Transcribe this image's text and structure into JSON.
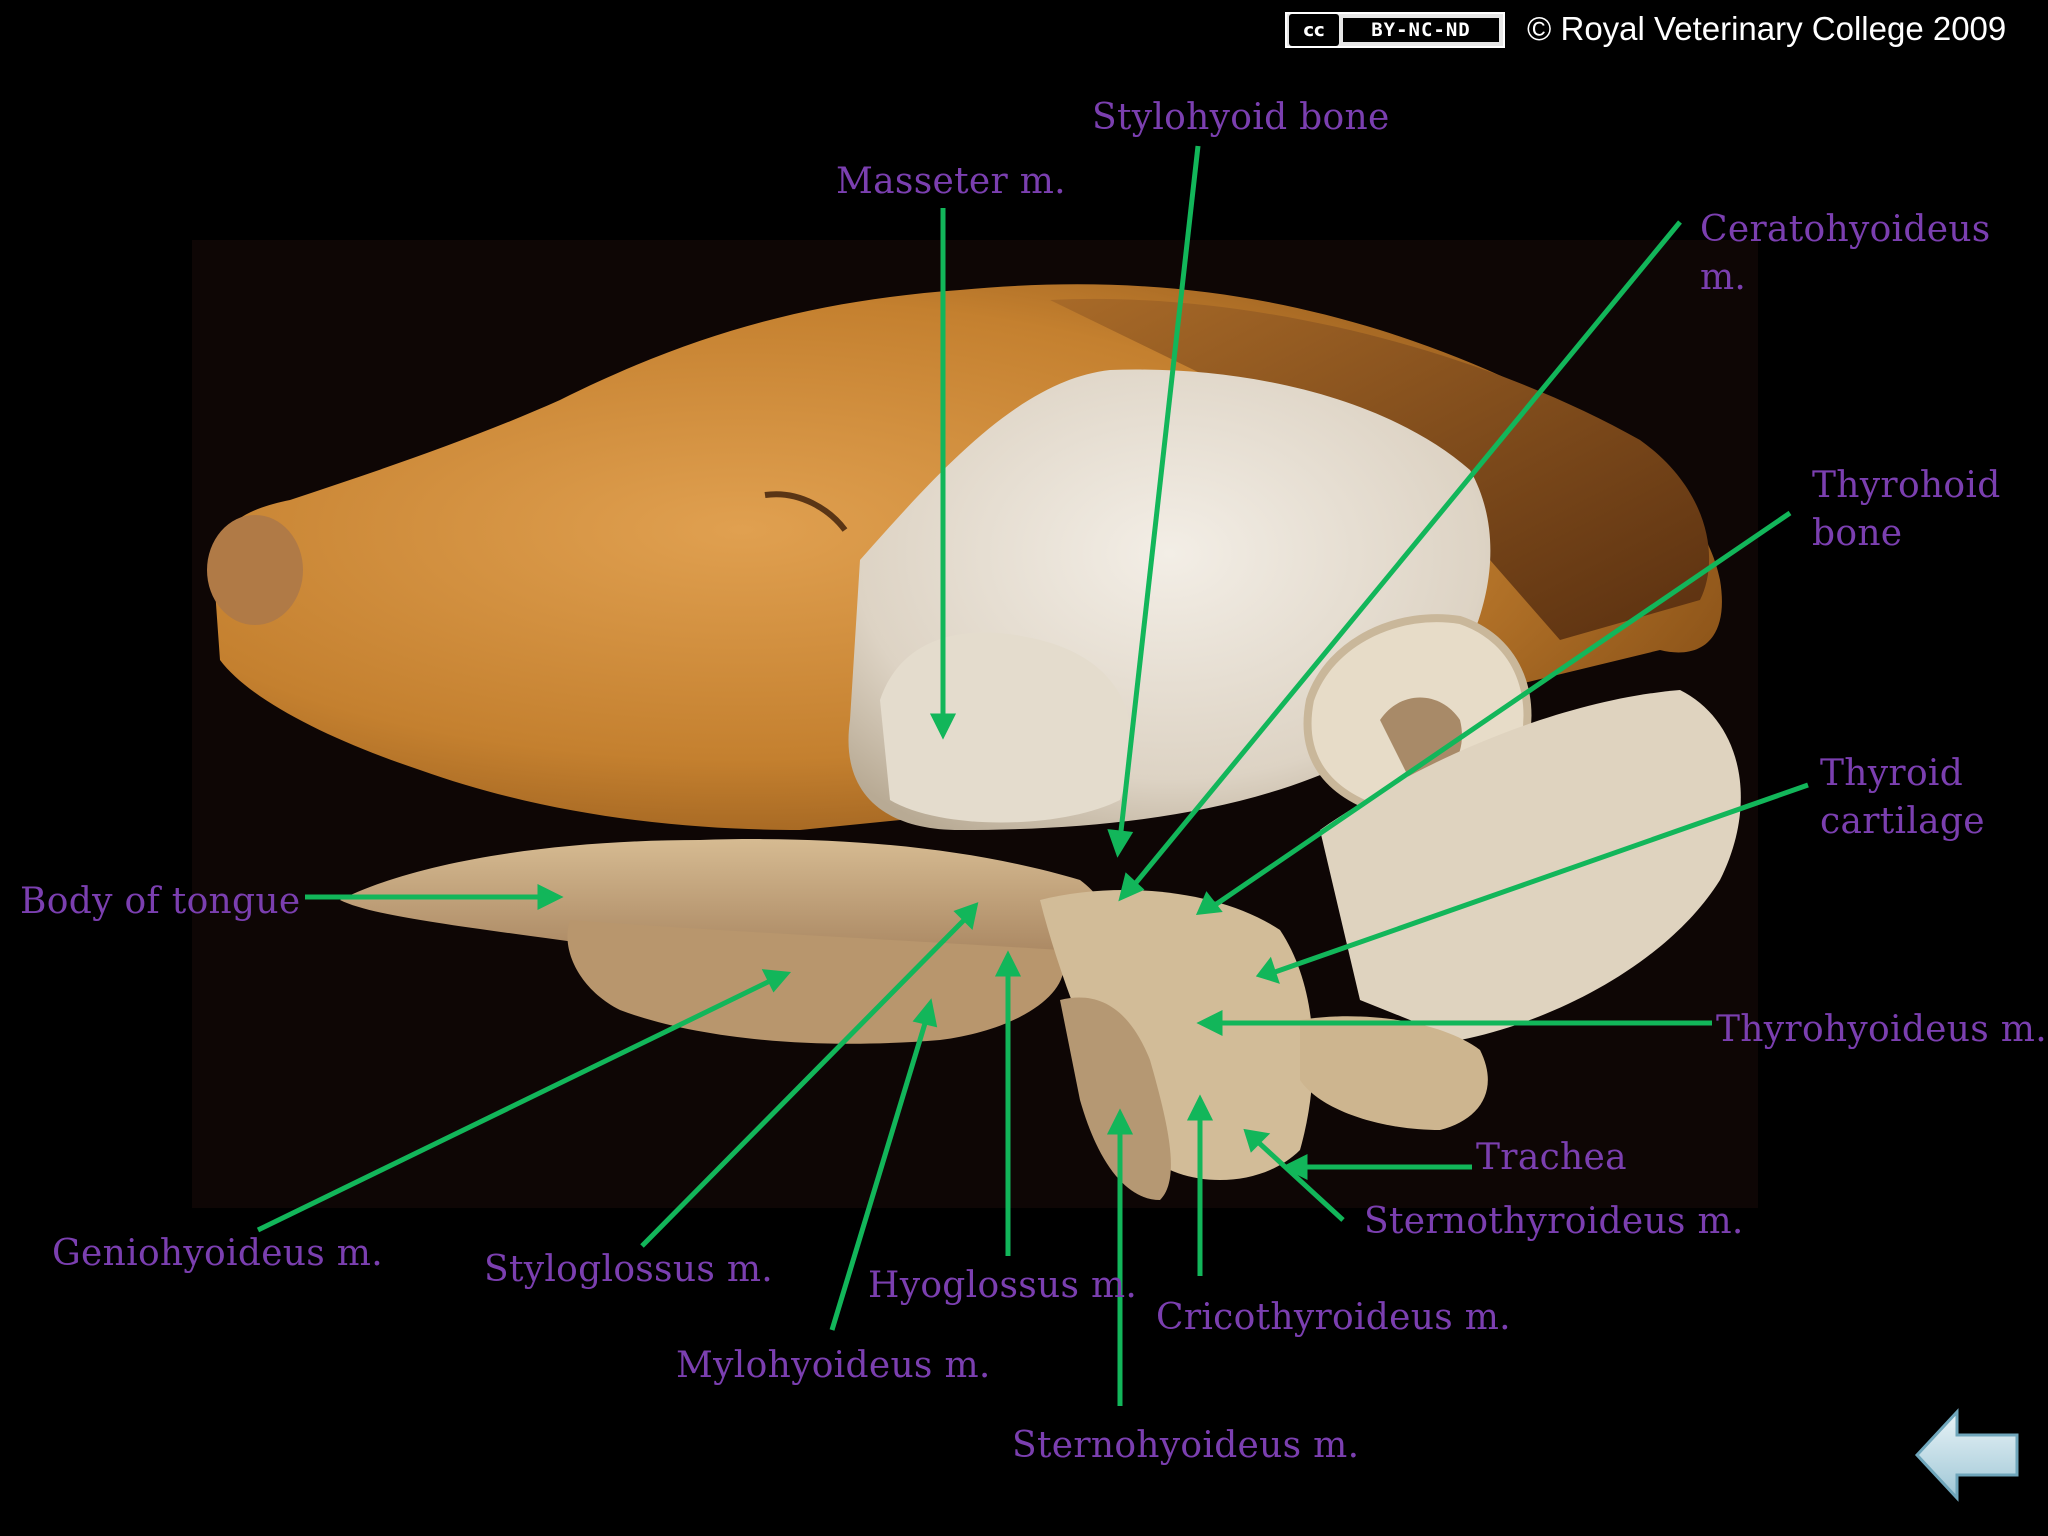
{
  "header": {
    "license_badge": "BY-NC-ND",
    "license_logo": "cc",
    "copyright": "© Royal Veterinary College 2009"
  },
  "labels": {
    "stylohyoid_bone": "Stylohyoid bone",
    "masseter": "Masseter m.",
    "ceratohyoideus": "Ceratohyoideus m.",
    "thyrohoid_bone": "Thyrohoid\nbone",
    "thyroid_cartilage": "Thyroid\ncartilage",
    "body_of_tongue": "Body of tongue",
    "thyrohyoideus": "Thyrohyoideus m.",
    "trachea": "Trachea",
    "sternothyroideus": "Sternothyroideus m.",
    "geniohyoideus": "Geniohyoideus m.",
    "styloglossus": "Styloglossus m.",
    "hyoglossus": "Hyoglossus m.",
    "cricothyroideus": "Cricothyroideus m.",
    "mylohyoideus": "Mylohyoideus m.",
    "sternohyoideus": "Sternohyoideus m."
  },
  "colors": {
    "label_text": "#7b3fb0",
    "pointer_line": "#12b65a",
    "background": "#000000",
    "fur": "#c98a3c",
    "tissue": "#d9c3a0"
  },
  "icons": {
    "nav": "back-arrow-icon"
  }
}
